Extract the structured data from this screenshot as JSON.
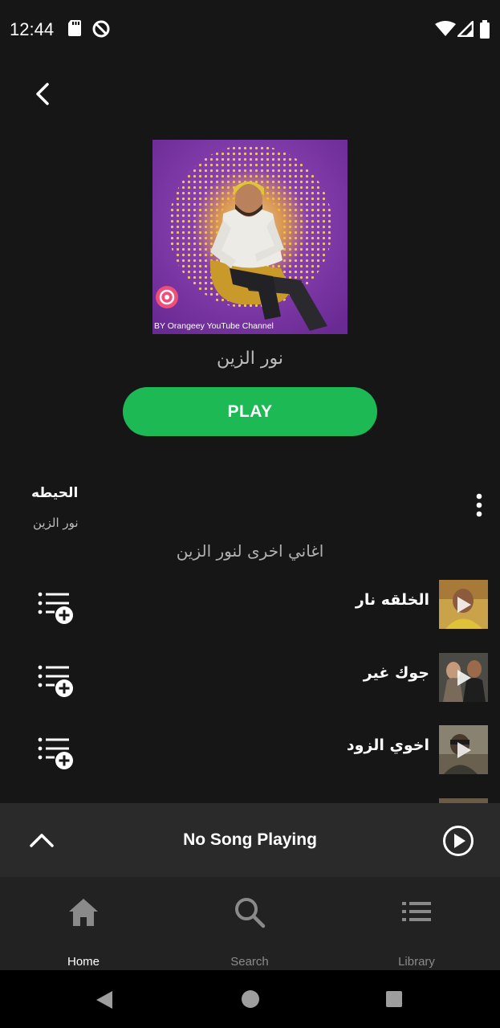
{
  "status_bar": {
    "time": "12:44",
    "icons_left": [
      "sd-card-icon",
      "data-saver-icon"
    ],
    "icons_right": [
      "wifi-icon",
      "signal-icon",
      "battery-icon"
    ]
  },
  "header": {
    "back_icon": "chevron-left-icon"
  },
  "album": {
    "caption": "BY Orangeey YouTube Channel",
    "artist_name": "نور الزين"
  },
  "play_button": {
    "label": "PLAY"
  },
  "current_track": {
    "title": "الحيطه",
    "artist": "نور الزين",
    "more_icon": "more-vertical-icon"
  },
  "other_songs": {
    "heading": "اغاني اخرى لنور الزين",
    "items": [
      {
        "title": "الخلقه نار"
      },
      {
        "title": "جوك غير"
      },
      {
        "title": "اخوي الزود"
      }
    ]
  },
  "mini_player": {
    "title": "No Song Playing",
    "expand_icon": "chevron-up-icon",
    "play_icon": "play-circle-icon"
  },
  "bottom_nav": {
    "items": [
      {
        "label": "Home",
        "icon": "home-icon",
        "active": true
      },
      {
        "label": "Search",
        "icon": "search-icon",
        "active": false
      },
      {
        "label": "Library",
        "icon": "library-list-icon",
        "active": false
      }
    ]
  },
  "system_nav": {
    "icons": [
      "back-triangle-icon",
      "home-circle-icon",
      "recents-square-icon"
    ]
  },
  "colors": {
    "background": "#161616",
    "accent": "#1db954",
    "mini_player_bg": "#2a2a2a",
    "nav_bg": "#222222",
    "nav_active": "#ffffff",
    "nav_inactive": "#8a8a8a"
  }
}
